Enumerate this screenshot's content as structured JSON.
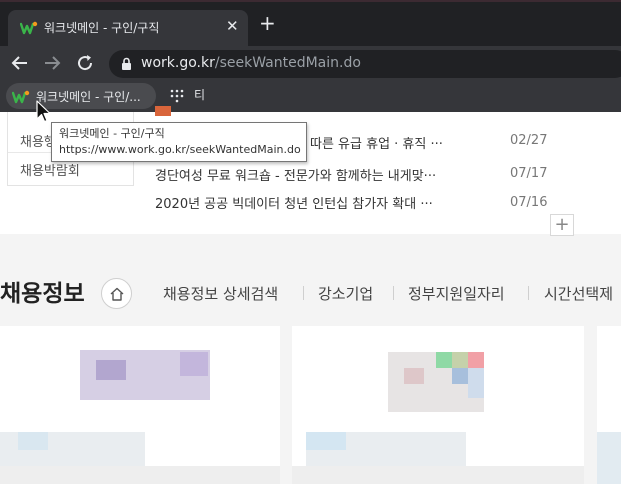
{
  "browser": {
    "tab_title": "워크넷메인 - 구인/구직",
    "close_glyph": "✕",
    "new_tab_glyph": "+",
    "url_host": "work.go.kr",
    "url_path": "/seekWantedMain.do",
    "bookmarks": [
      {
        "label": "워크넷메인 - 구인/..."
      },
      {
        "label": "티"
      }
    ],
    "tooltip_title": "워크넷메인 - 구인/구직",
    "tooltip_url": "https://www.work.go.kr/seekWantedMain.do"
  },
  "sidebar": {
    "items": [
      "채용행",
      "채용박람회"
    ]
  },
  "news": {
    "items": [
      {
        "title": "따른 유급 휴업 · 휴직 ···",
        "date": "02/27"
      },
      {
        "title": "경단여성 무료 워크숍 - 전문가와 함께하는 내게맞···",
        "date": "07/17"
      },
      {
        "title": "2020년 공공 빅데이터 청년 인턴십 참가자 확대 ···",
        "date": "07/16"
      }
    ],
    "more_glyph": "+"
  },
  "section": {
    "title": "채용정보",
    "menu": [
      "채용정보 상세검색",
      "강소기업",
      "정부지원일자리",
      "시간선택제"
    ]
  },
  "colors": {
    "favicon_green": "#3ab54a",
    "favicon_orange": "#f39a1e",
    "chrome_dark": "#202124",
    "chrome_mid": "#35363a"
  },
  "icons": {
    "back": "arrow-left-icon",
    "forward": "arrow-right-icon",
    "reload": "reload-icon",
    "lock": "lock-icon",
    "home": "home-icon",
    "apps": "apps-grid-icon"
  }
}
